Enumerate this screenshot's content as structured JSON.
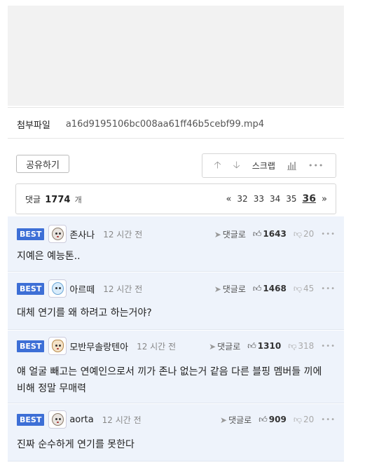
{
  "attachment": {
    "label": "첨부파일",
    "filename": "a16d9195106bc008aa61ff46b5cebf99.mp4"
  },
  "share": {
    "label": "공유하기"
  },
  "actions": {
    "up_icon": "arrow-up-icon",
    "down_icon": "arrow-down-icon",
    "scrap_label": "스크랩",
    "stats_icon": "bar-chart-icon",
    "more_icon": "more-dots-icon"
  },
  "comments_header": {
    "label": "댓글",
    "count": "1774",
    "unit": "개",
    "pages": [
      "32",
      "33",
      "34",
      "35",
      "36"
    ],
    "current_page": "36",
    "prev_icon": "«",
    "next_icon": "»"
  },
  "comments": [
    {
      "badge": "BEST",
      "nick": "존사나",
      "time": "12 시간 전",
      "reply_label": "댓글로",
      "likes": "1643",
      "dislikes": "20",
      "text": "지예은 예능톤.."
    },
    {
      "badge": "BEST",
      "nick": "아르떼",
      "time": "12 시간 전",
      "reply_label": "댓글로",
      "likes": "1468",
      "dislikes": "45",
      "text": "대체 연기를 왜 하려고 하는거야?"
    },
    {
      "badge": "BEST",
      "nick": "모반무솔랑텐아",
      "time": "12 시간 전",
      "reply_label": "댓글로",
      "likes": "1310",
      "dislikes": "318",
      "text": "얘 얼굴 빼고는 연예인으로서 끼가 존나 없는거 같음 다른 블핑 멤버들 끼에 비해 정말 무매력"
    },
    {
      "badge": "BEST",
      "nick": "aorta",
      "time": "12 시간 전",
      "reply_label": "댓글로",
      "likes": "909",
      "dislikes": "20",
      "text": "진짜 순수하게 연기를 못한다"
    }
  ]
}
